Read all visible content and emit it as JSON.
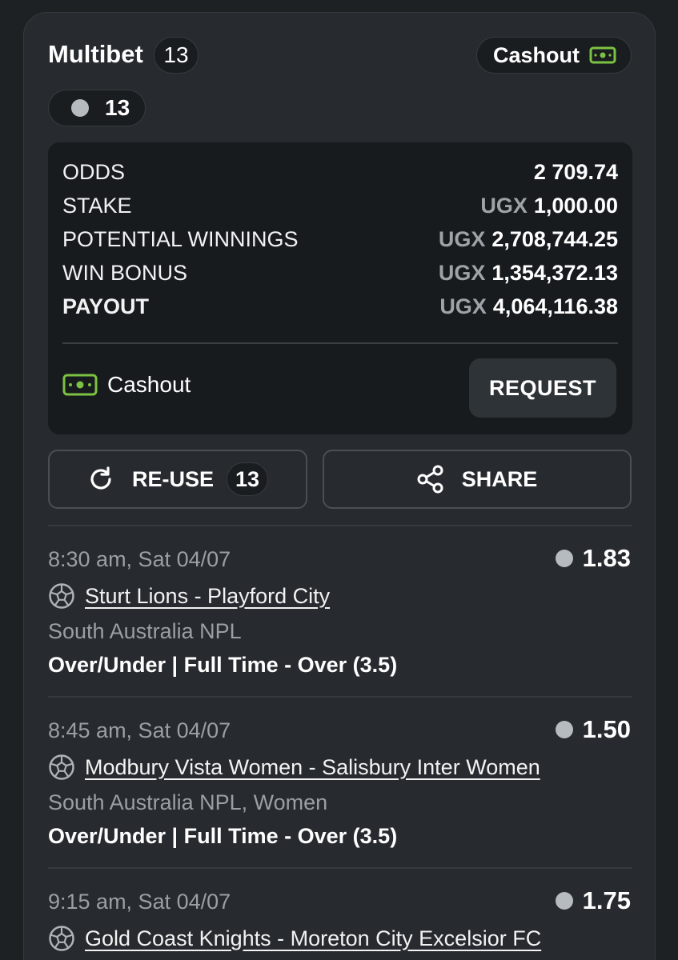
{
  "header": {
    "title": "Multibet",
    "count": "13",
    "cashout_label": "Cashout"
  },
  "status": {
    "count": "13"
  },
  "summary": {
    "rows": [
      {
        "label": "ODDS",
        "currency": "",
        "value": "2 709.74"
      },
      {
        "label": "STAKE",
        "currency": "UGX",
        "value": "1,000.00"
      },
      {
        "label": "POTENTIAL WINNINGS",
        "currency": "UGX",
        "value": "2,708,744.25"
      },
      {
        "label": "WIN BONUS",
        "currency": "UGX",
        "value": "1,354,372.13"
      },
      {
        "label": "PAYOUT",
        "currency": "UGX",
        "value": "4,064,116.38"
      }
    ],
    "cashout_label": "Cashout",
    "request_label": "REQUEST"
  },
  "actions": {
    "reuse_label": "RE-USE",
    "reuse_count": "13",
    "share_label": "SHARE"
  },
  "selections": [
    {
      "time": "8:30 am, Sat 04/07",
      "odds": "1.83",
      "match": "Sturt Lions - Playford City",
      "league": "South Australia NPL",
      "market": "Over/Under | Full Time - Over (3.5)"
    },
    {
      "time": "8:45 am, Sat 04/07",
      "odds": "1.50",
      "match": "Modbury Vista Women - Salisbury Inter Women",
      "league": "South Australia NPL, Women",
      "market": "Over/Under | Full Time - Over (3.5)"
    },
    {
      "time": "9:15 am, Sat 04/07",
      "odds": "1.75",
      "match": "Gold Coast Knights - Moreton City Excelsior FC",
      "league": "",
      "market": ""
    }
  ],
  "colors": {
    "accent_green": "#7cc242",
    "card_bg": "#272b2f",
    "summary_bg": "#181b1e",
    "page_bg": "#1e2124"
  },
  "icons": {
    "cashout": "cash-icon",
    "reuse": "refresh-icon",
    "share": "share-icon",
    "sport": "soccer-ball-icon",
    "status": "status-dot-icon"
  }
}
